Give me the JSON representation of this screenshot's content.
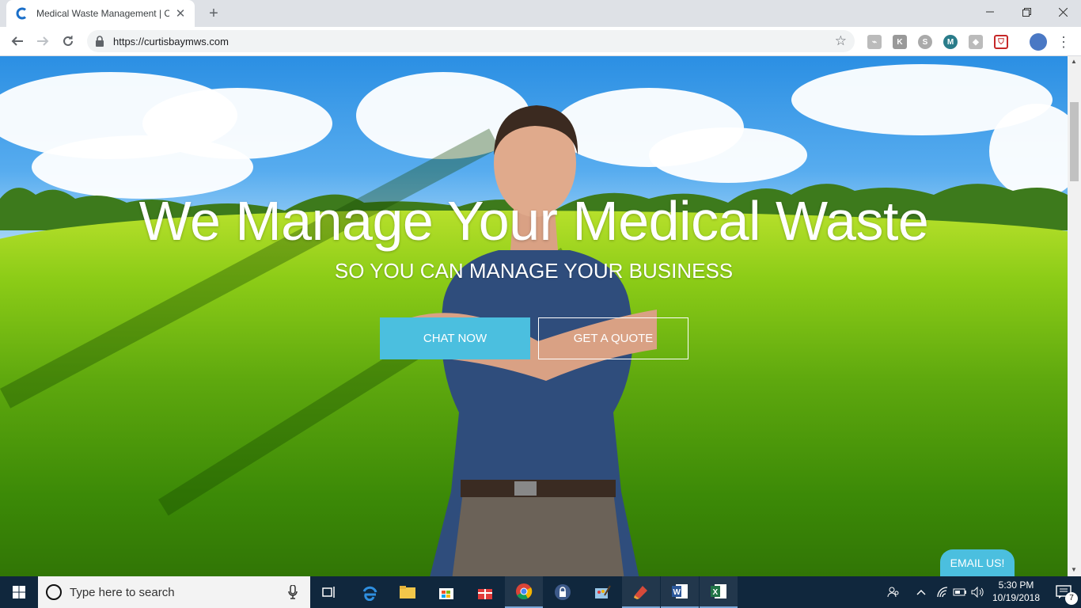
{
  "browser": {
    "tab_title": "Medical Waste Management | Cu",
    "url": "https://curtisbaymws.com"
  },
  "hero": {
    "title": "We Manage Your Medical Waste",
    "subtitle": "SO YOU CAN MANAGE YOUR BUSINESS",
    "chat_button": "CHAT NOW",
    "quote_button": "GET A QUOTE",
    "email_button": "EMAIL US!"
  },
  "taskbar": {
    "search_placeholder": "Type here to search",
    "time": "5:30 PM",
    "date": "10/19/2018",
    "notification_count": "7"
  },
  "colors": {
    "accent": "#4bbfdf",
    "taskbar": "#10273d"
  }
}
